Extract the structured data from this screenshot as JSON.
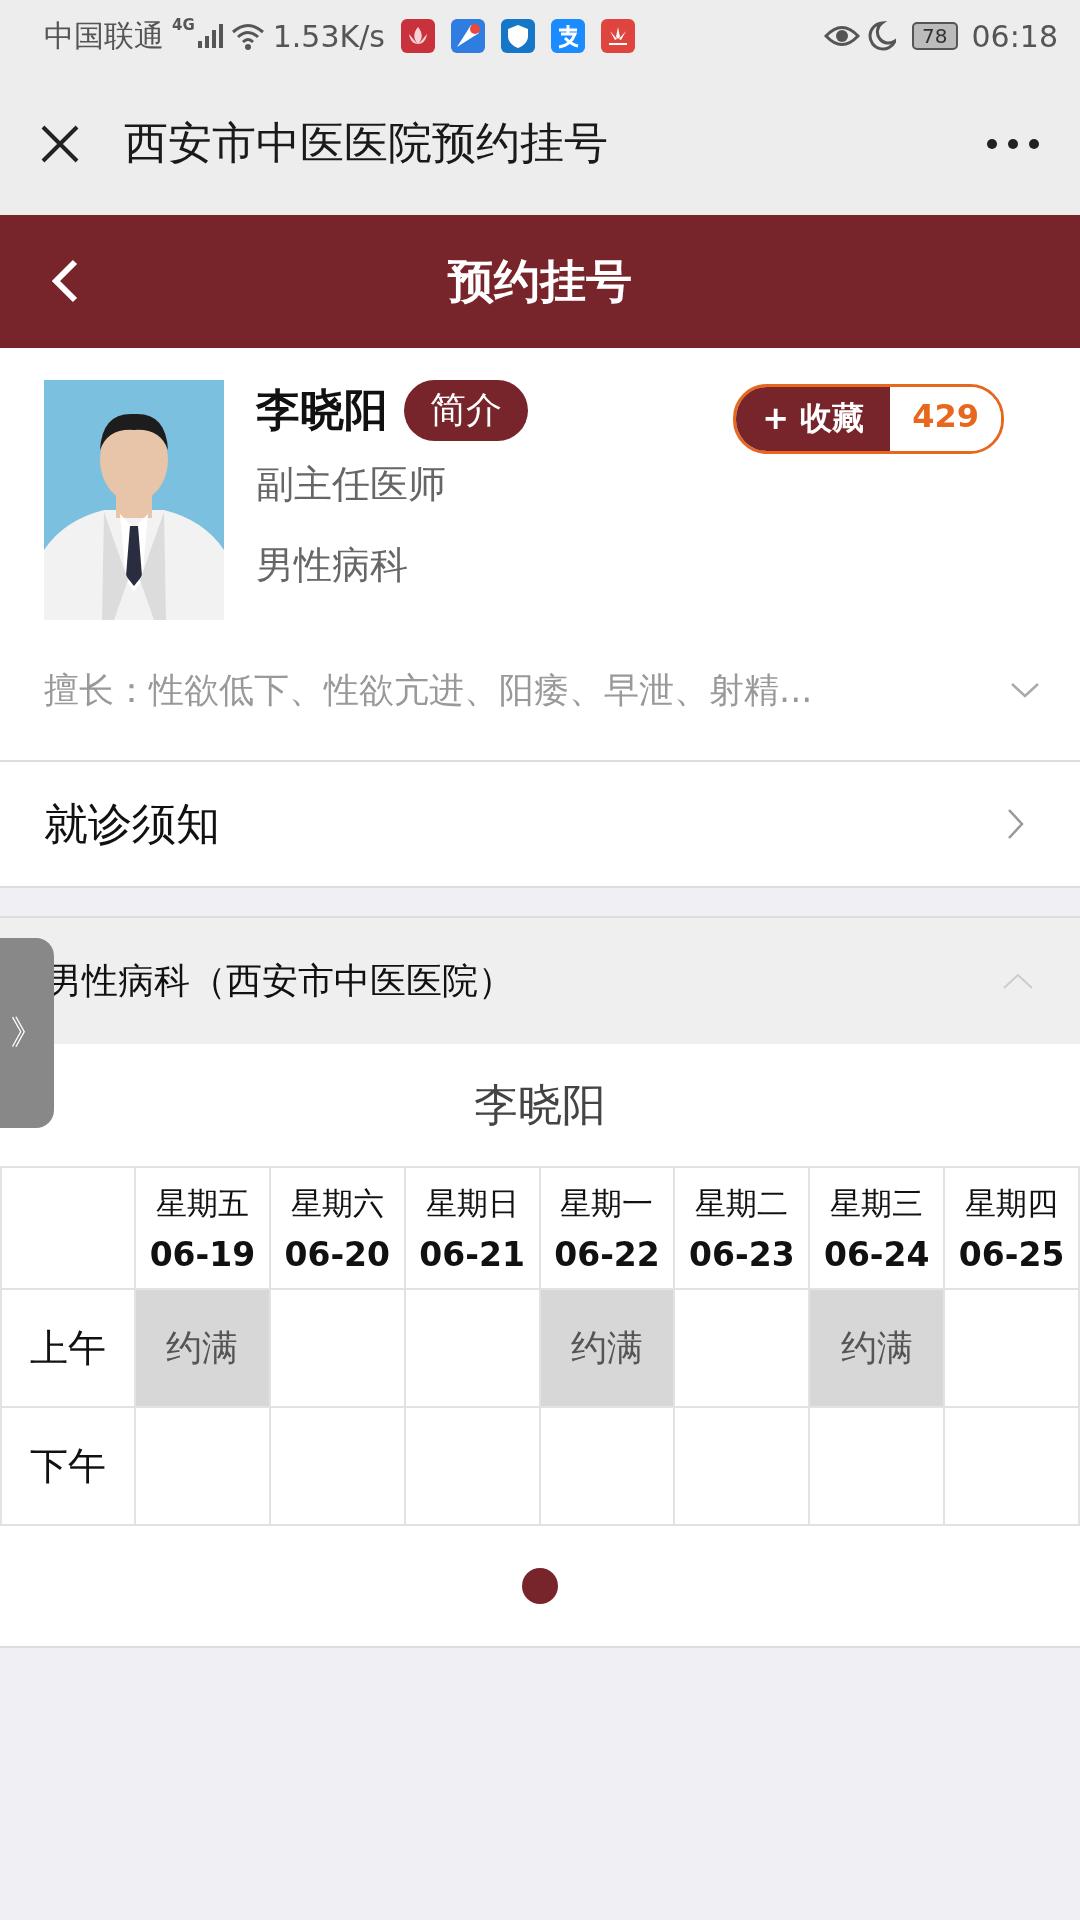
{
  "status_bar": {
    "carrier": "中国联通",
    "network": "4G",
    "speed": "1.53K/s",
    "battery": "78",
    "time": "06:18"
  },
  "title_bar": {
    "title": "西安市中医医院预约挂号"
  },
  "header": {
    "title": "预约挂号"
  },
  "doctor": {
    "name": "李晓阳",
    "intro_button": "简介",
    "title": "副主任医师",
    "department": "男性病科",
    "favorite_label": "+ 收藏",
    "favorite_count": "429",
    "specialty": "擅长：性欲低下、性欲亢进、阳痿、早泄、射精..."
  },
  "notice": {
    "label": "就诊须知"
  },
  "schedule": {
    "section_title": "男性病科（西安市中医医院）",
    "expanded": true,
    "side_tab": "》",
    "doctor_name": "李晓阳",
    "days": [
      {
        "weekday": "星期五",
        "date": "06-19"
      },
      {
        "weekday": "星期六",
        "date": "06-20"
      },
      {
        "weekday": "星期日",
        "date": "06-21"
      },
      {
        "weekday": "星期一",
        "date": "06-22"
      },
      {
        "weekday": "星期二",
        "date": "06-23"
      },
      {
        "weekday": "星期三",
        "date": "06-24"
      },
      {
        "weekday": "星期四",
        "date": "06-25"
      }
    ],
    "rows": [
      {
        "label": "上午",
        "cells": [
          {
            "full": true,
            "text": "约满"
          },
          {
            "full": false
          },
          {
            "full": false
          },
          {
            "full": true,
            "text": "约满"
          },
          {
            "full": false
          },
          {
            "full": true,
            "text": "约满"
          },
          {
            "full": false
          }
        ]
      },
      {
        "label": "下午",
        "cells": [
          {
            "full": false
          },
          {
            "full": false
          },
          {
            "full": false
          },
          {
            "full": false
          },
          {
            "full": false
          },
          {
            "full": false
          },
          {
            "full": false
          }
        ]
      }
    ],
    "pages": [
      {
        "selected": true
      }
    ]
  }
}
